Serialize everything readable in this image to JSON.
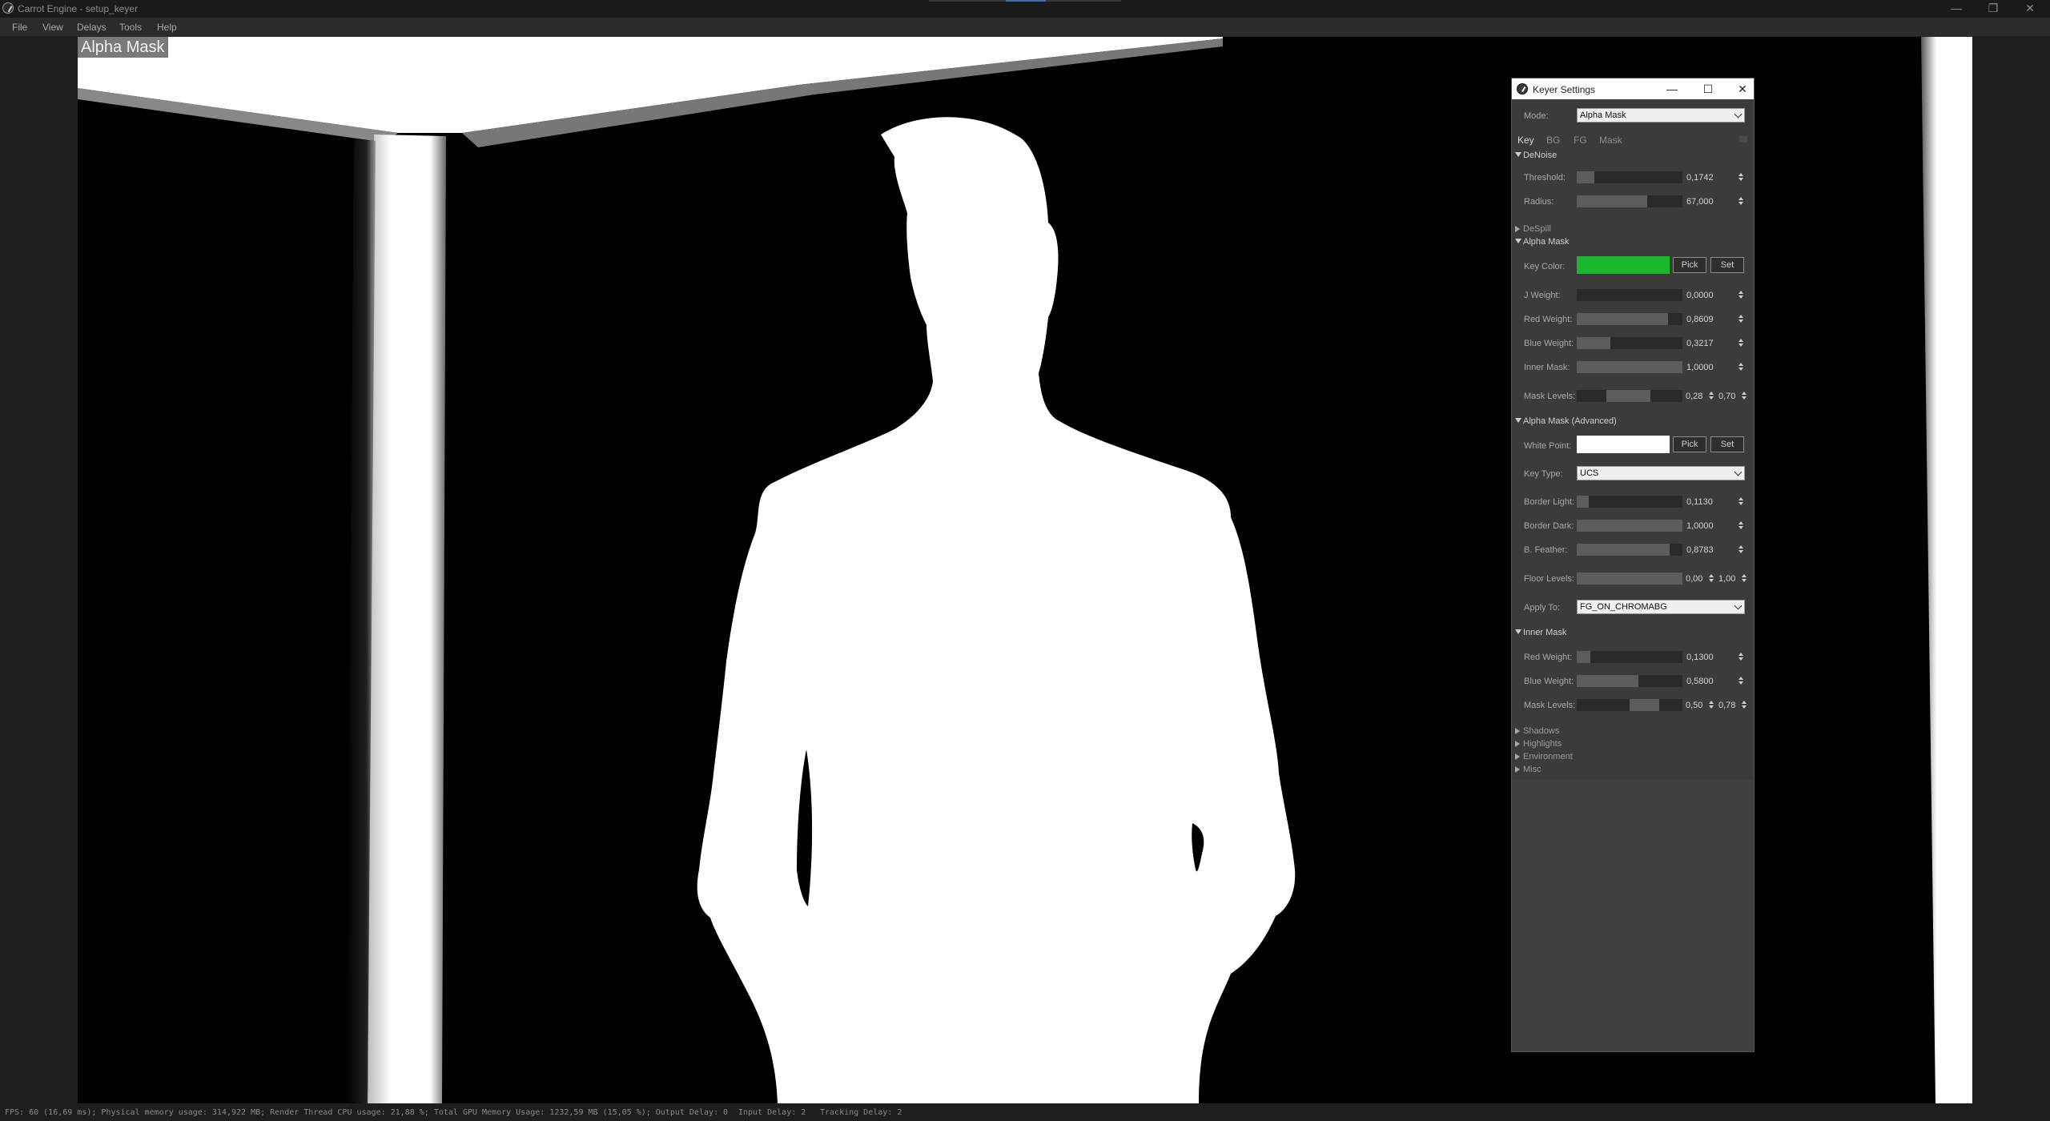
{
  "window": {
    "title": "Carrot Engine - setup_keyer",
    "controls": {
      "minimize": "—",
      "restore": "❐",
      "close": "✕"
    }
  },
  "menu": [
    "File",
    "View",
    "Delays",
    "Tools",
    "Help"
  ],
  "viewport": {
    "label": "Alpha Mask"
  },
  "keyer": {
    "title": "Keyer Settings",
    "controls": {
      "minimize": "—",
      "maximize": "☐",
      "close": "✕"
    },
    "mode": {
      "label": "Mode:",
      "value": "Alpha Mask"
    },
    "tabs": [
      "Key",
      "BG",
      "FG",
      "Mask"
    ],
    "denoise": {
      "title": "DeNoise",
      "threshold": {
        "label": "Threshold:",
        "value": "0,1742",
        "fill": 0.17
      },
      "radius": {
        "label": "Radius:",
        "value": "67,000",
        "fill": 0.67
      }
    },
    "despill": {
      "title": "DeSpill"
    },
    "alpha_mask": {
      "title": "Alpha Mask",
      "key_color": {
        "label": "Key Color:",
        "color": "#1ab82c",
        "pick": "Pick",
        "set": "Set"
      },
      "j_weight": {
        "label": "J Weight:",
        "value": "0,0000",
        "fill": 0.0
      },
      "red_weight": {
        "label": "Red Weight:",
        "value": "0,8609",
        "fill": 0.86
      },
      "blue_weight": {
        "label": "Blue Weight:",
        "value": "0,3217",
        "fill": 0.32
      },
      "inner_mask": {
        "label": "Inner Mask:",
        "value": "1,0000",
        "fill": 1.0
      },
      "mask_levels": {
        "label": "Mask Levels:",
        "low": "0,28",
        "high": "0,70",
        "low_f": 0.28,
        "high_f": 0.7
      }
    },
    "alpha_mask_adv": {
      "title": "Alpha Mask (Advanced)",
      "white_point": {
        "label": "White Point:",
        "color": "#ffffff",
        "pick": "Pick",
        "set": "Set"
      },
      "key_type": {
        "label": "Key Type:",
        "value": "UCS"
      },
      "border_light": {
        "label": "Border Light:",
        "value": "0,1130",
        "fill": 0.11
      },
      "border_dark": {
        "label": "Border Dark:",
        "value": "1,0000",
        "fill": 1.0
      },
      "b_feather": {
        "label": "B. Feather:",
        "value": "0,8783",
        "fill": 0.88
      },
      "floor_levels": {
        "label": "Floor Levels:",
        "low": "0,00",
        "high": "1,00",
        "low_f": 0.0,
        "high_f": 1.0
      },
      "apply_to": {
        "label": "Apply To:",
        "value": "FG_ON_CHROMABG"
      }
    },
    "inner_mask": {
      "title": "Inner Mask",
      "red_weight": {
        "label": "Red Weight:",
        "value": "0,1300",
        "fill": 0.13
      },
      "blue_weight": {
        "label": "Blue Weight:",
        "value": "0,5800",
        "fill": 0.58
      },
      "mask_levels": {
        "label": "Mask Levels:",
        "low": "0,50",
        "high": "0,78",
        "low_f": 0.5,
        "high_f": 0.78
      }
    },
    "collapsed": [
      "Shadows",
      "Highlights",
      "Environment",
      "Misc"
    ]
  },
  "status": {
    "fps": "FPS: 60 (16,69 ms); Physical memory usage: 314,922 MB; Render Thread CPU usage: 21,88 %; Total GPU Memory Usage: 1232,59 MB (15,05 %); Output Delay: 0",
    "input_delay": "Input Delay: 2",
    "tracking_delay": "Tracking Delay: 2"
  }
}
